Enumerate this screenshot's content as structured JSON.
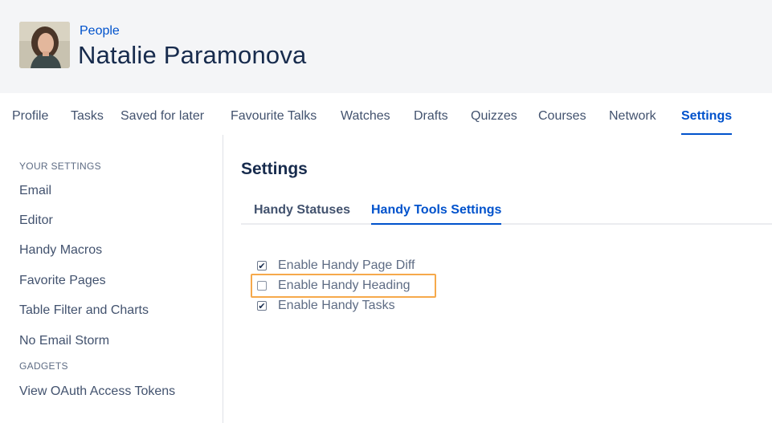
{
  "header": {
    "breadcrumb": "People",
    "title": "Natalie Paramonova"
  },
  "tabs": [
    {
      "label": "Profile"
    },
    {
      "label": "Tasks"
    },
    {
      "label": "Saved for later"
    },
    {
      "label": "Favourite Talks"
    },
    {
      "label": "Watches"
    },
    {
      "label": "Drafts"
    },
    {
      "label": "Quizzes"
    },
    {
      "label": "Courses"
    },
    {
      "label": "Network"
    },
    {
      "label": "Settings",
      "active": true
    }
  ],
  "sidebar": {
    "your_settings_heading": "YOUR SETTINGS",
    "items": [
      {
        "label": "Email"
      },
      {
        "label": "Editor"
      },
      {
        "label": "Handy Macros"
      },
      {
        "label": "Favorite Pages"
      },
      {
        "label": "Table Filter and Charts"
      },
      {
        "label": "No Email Storm"
      }
    ],
    "gadgets_heading": "GADGETS",
    "gadget_items": [
      {
        "label": "View OAuth Access Tokens"
      }
    ]
  },
  "content": {
    "title": "Settings",
    "subtabs": [
      {
        "label": "Handy Statuses"
      },
      {
        "label": "Handy Tools Settings",
        "active": true
      }
    ],
    "options": [
      {
        "label": "Enable Handy Page Diff",
        "checked": true
      },
      {
        "label": "Enable Handy Heading",
        "checked": false,
        "highlighted": true
      },
      {
        "label": "Enable Handy Tasks",
        "checked": true
      }
    ]
  },
  "colors": {
    "accent": "#0052cc",
    "highlight": "#f6a94b",
    "header_bg": "#f4f5f7"
  }
}
